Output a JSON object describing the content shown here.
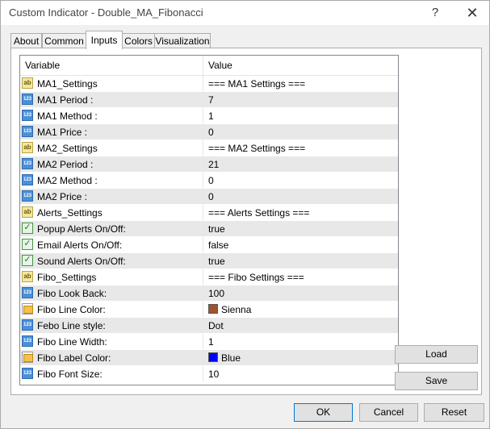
{
  "window": {
    "title": "Custom Indicator - Double_MA_Fibonacci",
    "help_glyph": "?",
    "close_glyph": "✕"
  },
  "tabs": [
    {
      "label": "About",
      "active": false
    },
    {
      "label": "Common",
      "active": false
    },
    {
      "label": "Inputs",
      "active": true
    },
    {
      "label": "Colors",
      "active": false
    },
    {
      "label": "Visualization",
      "active": false
    }
  ],
  "grid": {
    "columns": [
      "Variable",
      "Value"
    ],
    "rows": [
      {
        "icon": "string-icon",
        "variable": "MA1_Settings",
        "value": "=== MA1 Settings ==="
      },
      {
        "icon": "number-icon",
        "variable": "MA1 Period :",
        "value": "7"
      },
      {
        "icon": "number-icon",
        "variable": "MA1 Method :",
        "value": "1"
      },
      {
        "icon": "number-icon",
        "variable": "MA1 Price :",
        "value": "0"
      },
      {
        "icon": "string-icon",
        "variable": "MA2_Settings",
        "value": "=== MA2 Settings ==="
      },
      {
        "icon": "number-icon",
        "variable": "MA2 Period :",
        "value": "21"
      },
      {
        "icon": "number-icon",
        "variable": "MA2 Method :",
        "value": "0"
      },
      {
        "icon": "number-icon",
        "variable": "MA2 Price :",
        "value": "0"
      },
      {
        "icon": "string-icon",
        "variable": "Alerts_Settings",
        "value": "=== Alerts Settings ==="
      },
      {
        "icon": "bool-icon",
        "variable": "Popup Alerts On/Off:",
        "value": "true"
      },
      {
        "icon": "bool-icon",
        "variable": "Email Alerts On/Off:",
        "value": "false"
      },
      {
        "icon": "bool-icon",
        "variable": "Sound Alerts On/Off:",
        "value": "true"
      },
      {
        "icon": "string-icon",
        "variable": "Fibo_Settings",
        "value": "=== Fibo Settings ==="
      },
      {
        "icon": "number-icon",
        "variable": "Fibo Look Back:",
        "value": "100"
      },
      {
        "icon": "color-icon",
        "variable": "Fibo Line Color:",
        "value": "Sienna",
        "swatch": "#a0522d"
      },
      {
        "icon": "number-icon",
        "variable": "Febo Line style:",
        "value": "Dot"
      },
      {
        "icon": "number-icon",
        "variable": "Fibo Line Width:",
        "value": "1"
      },
      {
        "icon": "color-icon",
        "variable": "Fibo Label Color:",
        "value": "Blue",
        "swatch": "#0000ff"
      },
      {
        "icon": "number-icon",
        "variable": "Fibo Font Size:",
        "value": "10"
      }
    ]
  },
  "side_buttons": {
    "load": "Load",
    "save": "Save"
  },
  "footer_buttons": {
    "ok": "OK",
    "cancel": "Cancel",
    "reset": "Reset"
  }
}
